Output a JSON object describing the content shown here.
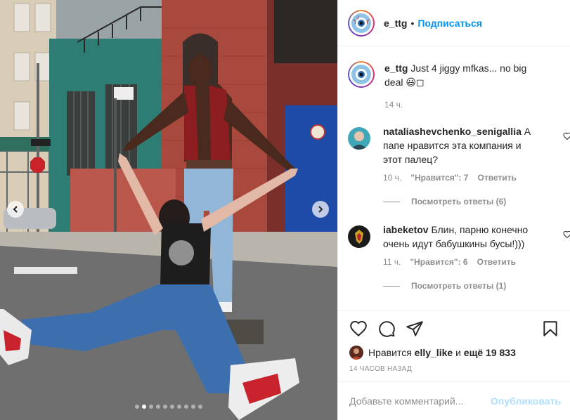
{
  "header": {
    "username": "e_ttg",
    "separator": "•",
    "follow_label": "Подписаться"
  },
  "caption": {
    "username": "e_ttg",
    "text": "Just 4 jiggy mfkas... no big deal 😃◻",
    "time": "14 ч."
  },
  "comments": [
    {
      "username": "nataliashevchenko_senigallia",
      "text": "А папе нравится эта компания и этот палец?",
      "time": "10 ч.",
      "likes": "\"Нравится\": 7",
      "reply": "Ответить",
      "view_replies": "Посмотреть ответы (6)"
    },
    {
      "username": "iabeketov",
      "text": "Блин, парню конечно очень идут бабушкины бусы!)))",
      "time": "11 ч.",
      "likes": "\"Нравится\": 6",
      "reply": "Ответить",
      "view_replies": "Посмотреть ответы (1)"
    }
  ],
  "likes": {
    "prefix": "Нравится",
    "user": "elly_like",
    "middle": "и",
    "others": "ещё 19 833"
  },
  "date": "14 ЧАСОВ НАЗАД",
  "add_comment": {
    "placeholder": "Добавьте комментарий...",
    "publish_label": "Опубликовать"
  },
  "carousel": {
    "total": 10,
    "active_index": 1
  },
  "colors": {
    "accent": "#0095f6",
    "publish_disabled": "#b2dffc",
    "muted": "#8e8e8e",
    "text": "#262626"
  },
  "icons": [
    "heart-icon",
    "comment-icon",
    "share-icon",
    "bookmark-icon",
    "chevron-left-icon",
    "chevron-right-icon"
  ]
}
